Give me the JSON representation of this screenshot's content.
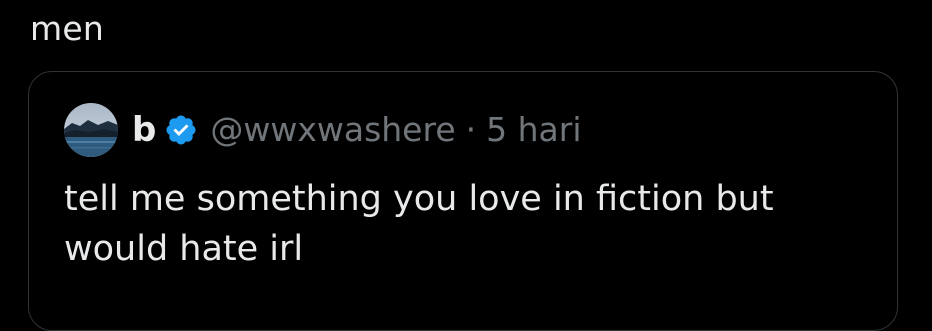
{
  "post": {
    "text": "men"
  },
  "quoted_post": {
    "avatar": "avatar-lake-landscape",
    "display_name": "b",
    "verified_icon": "verified-badge-icon",
    "handle": "@wwxwashere",
    "separator": "·",
    "timestamp": "5 hari",
    "text": "tell me something you love in fiction but would hate irl"
  },
  "colors": {
    "background": "#000000",
    "primary_text": "#e7e9ea",
    "secondary_text": "#71767b",
    "border": "#2f3336",
    "verified_blue": "#1d9bf0"
  }
}
